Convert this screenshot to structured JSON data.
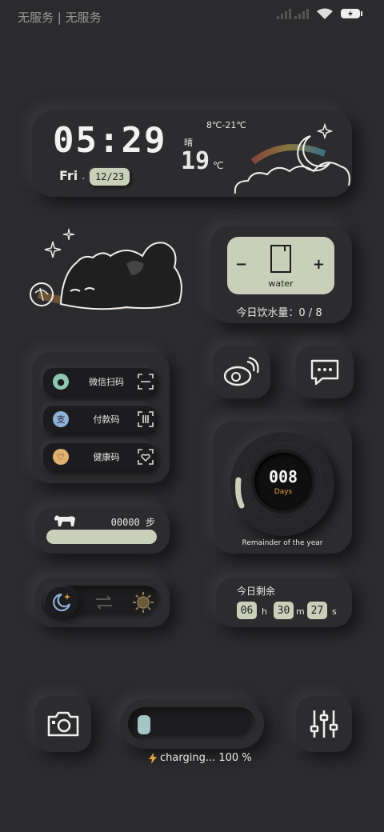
{
  "status_bar": {
    "carrier": "无服务 | 无服务",
    "icons": [
      "signal-icon",
      "wifi-icon",
      "battery-icon"
    ]
  },
  "clock": {
    "time": "05:29",
    "day": "Fri",
    "dot": ".",
    "date": "12/23",
    "weather": "晴",
    "temp_range": "8℃-21℃",
    "temp_now": "19",
    "temp_unit": "℃"
  },
  "water": {
    "minus": "−",
    "plus": "+",
    "label": "water",
    "intake_label": "今日饮水量：0 / 8"
  },
  "scan": {
    "items": [
      {
        "label": "微信扫码",
        "icon": "wechat-icon"
      },
      {
        "label": "付款码",
        "icon": "alipay-icon"
      },
      {
        "label": "健康码",
        "icon": "health-icon"
      }
    ]
  },
  "days": {
    "value": "008",
    "unit": "Days",
    "caption": "Remainder of the year"
  },
  "steps": {
    "value": "00000 步"
  },
  "countdown": {
    "title": "今日剩余",
    "hours": "06",
    "h": "h",
    "minutes": "30",
    "m": "m",
    "seconds": "27",
    "s": "s"
  },
  "battery": {
    "label": "charging... 100 %",
    "level": 1.0
  },
  "colors": {
    "background": "#2b2b2d",
    "sage": "#c9cfb8",
    "accent_orange": "#e0a045"
  }
}
